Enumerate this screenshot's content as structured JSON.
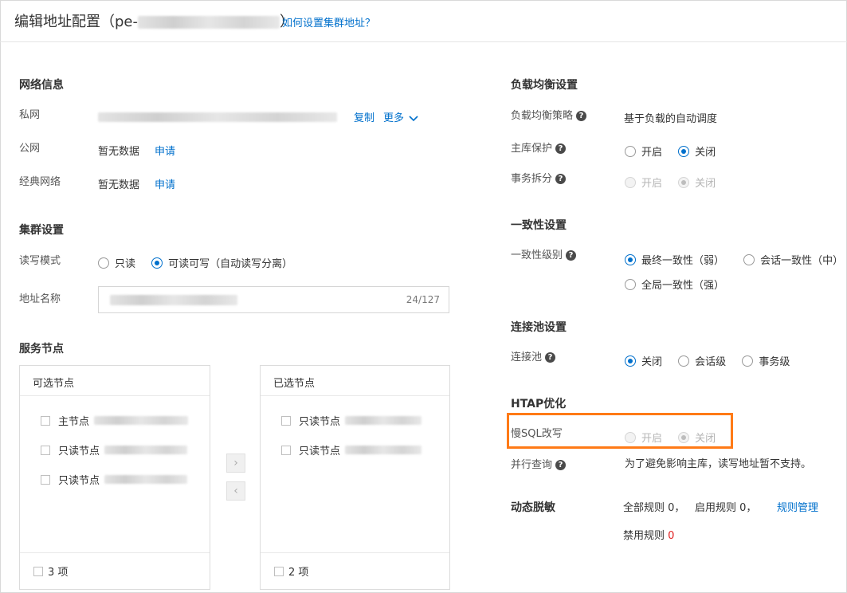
{
  "header": {
    "title_prefix": "编辑地址配置（pe-",
    "title_suffix": "）",
    "help_link": "如何设置集群地址？"
  },
  "network": {
    "title": "网络信息",
    "private_label": "私网",
    "copy": "复制",
    "more": "更多",
    "public_label": "公网",
    "public_value": "暂无数据",
    "public_apply": "申请",
    "classic_label": "经典网络",
    "classic_value": "暂无数据",
    "classic_apply": "申请"
  },
  "cluster": {
    "title": "集群设置",
    "rw_label": "读写模式",
    "rw_options": [
      "只读",
      "可读可写（自动读写分离）"
    ],
    "name_label": "地址名称",
    "name_count": "24/127"
  },
  "nodes": {
    "title": "服务节点",
    "available_title": "可选节点",
    "available_items": [
      "主节点",
      "只读节点",
      "只读节点"
    ],
    "available_count": "3 项",
    "selected_title": "已选节点",
    "selected_items": [
      "只读节点",
      "只读节点"
    ],
    "selected_count": "2 项",
    "move_right": "›",
    "move_left": "‹"
  },
  "lb": {
    "title": "负载均衡设置",
    "strategy_label": "负载均衡策略",
    "strategy_value": "基于负载的自动调度",
    "primary_label": "主库保护",
    "primary_options": [
      "开启",
      "关闭"
    ],
    "txsplit_label": "事务拆分",
    "txsplit_options": [
      "开启",
      "关闭"
    ]
  },
  "consistency": {
    "title": "一致性设置",
    "level_label": "一致性级别",
    "options": [
      "最终一致性（弱）",
      "会话一致性（中）",
      "全局一致性（强）"
    ]
  },
  "pool": {
    "title": "连接池设置",
    "label": "连接池",
    "options": [
      "关闭",
      "会话级",
      "事务级"
    ]
  },
  "htap": {
    "title": "HTAP优化",
    "slowsql_label": "慢SQL改写",
    "slowsql_options": [
      "开启",
      "关闭"
    ],
    "parallel_label": "并行查询",
    "parallel_value": "为了避免影响主库，读写地址暂不支持。"
  },
  "masking": {
    "title": "动态脱敏",
    "all_rules": "全部规则 0，",
    "enabled_rules": "启用规则 0，",
    "manage": "规则管理",
    "disabled_prefix": "禁用规则",
    "disabled_count": "0"
  },
  "colors": {
    "accent": "#0070cc",
    "highlight": "#ff7a16",
    "danger": "#e02020"
  },
  "help_icon": "?"
}
